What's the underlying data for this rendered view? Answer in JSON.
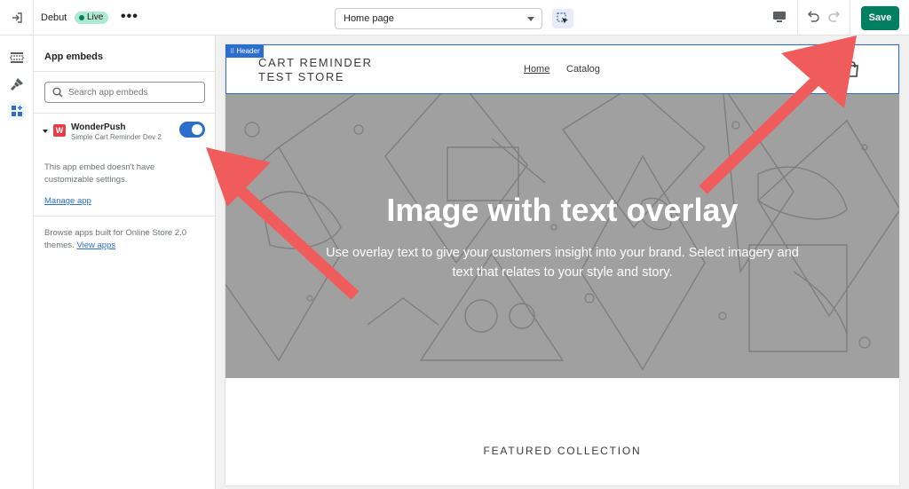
{
  "topbar": {
    "theme_name": "Debut",
    "status_badge": "Live",
    "more_label": "•••",
    "page_select_value": "Home page",
    "save_label": "Save"
  },
  "sidebar": {
    "title": "App embeds",
    "search_placeholder": "Search app embeds",
    "embed": {
      "logo_letter": "W",
      "name": "WonderPush",
      "subtitle": "Simple Cart Reminder Dev 2",
      "enabled": true
    },
    "note": "This app embed doesn't have customizable settings.",
    "manage_link": "Manage app",
    "browse_text": "Browse apps built for Online Store 2.0 themes.",
    "view_apps_link": "View apps"
  },
  "preview": {
    "header_tag": "Header",
    "store_name": "CART REMINDER TEST STORE",
    "nav": [
      "Home",
      "Catalog"
    ],
    "hero_title": "Image with text overlay",
    "hero_subtitle": "Use overlay text to give your customers insight into your brand. Select imagery and text that relates to your style and story.",
    "featured_title": "FEATURED COLLECTION"
  },
  "colors": {
    "save_green": "#008060",
    "accent_blue": "#2c6ecb",
    "live_badge_bg": "#aee9d1",
    "hero_overlay": "#a0a0a1",
    "annotation_arrow": "#f05b5b"
  },
  "icons": {
    "exit": "exit-icon",
    "sections": "sections-icon",
    "theme_settings": "brush-icon",
    "app_embeds": "app-embed-icon",
    "inspector": "select-cursor-icon",
    "device": "desktop-icon",
    "undo": "undo-icon",
    "redo": "redo-icon",
    "search": "search-icon",
    "cart": "bag-icon"
  }
}
